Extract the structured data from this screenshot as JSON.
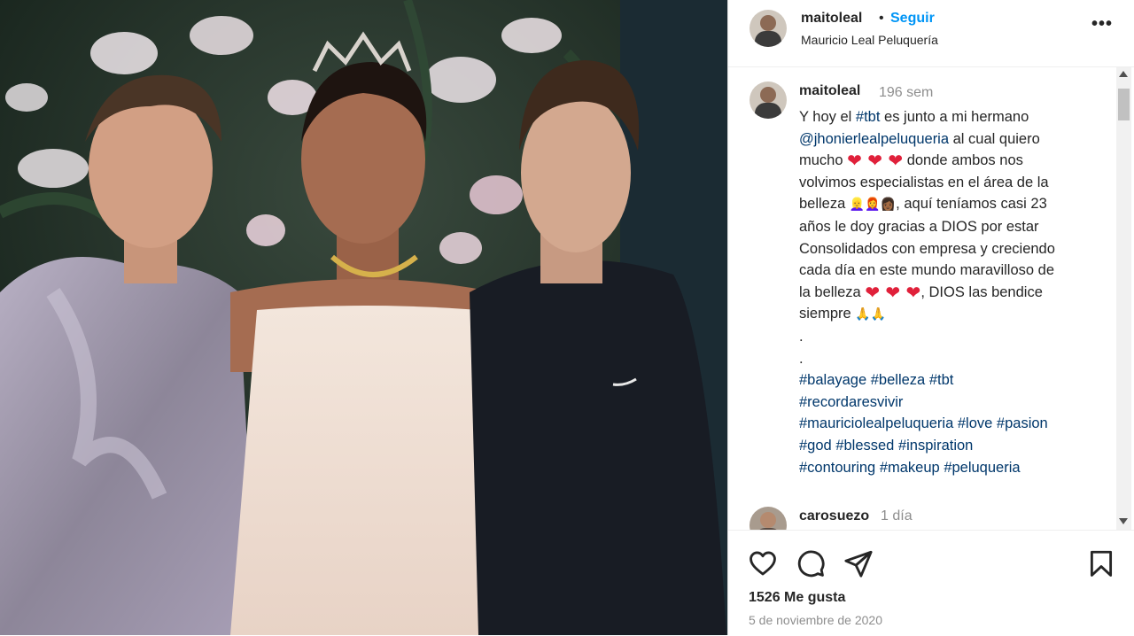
{
  "post": {
    "username": "maitoleal",
    "separator": "•",
    "follow_label": "Seguir",
    "location": "Mauricio Leal Peluquería",
    "more_label": "•••"
  },
  "caption": {
    "username": "maitoleal",
    "time": "196 sem",
    "line1_pre": "Y hoy el ",
    "line1_tag": "#tbt",
    "line1_post": " es junto a mi hermano",
    "mention": "@jhonierlealpeluqueria",
    "line2_post": " al cual quiero",
    "line3_pre": "mucho ",
    "line3_post": " donde ambos nos",
    "line4": "volvimos especialistas en el área de la",
    "line5_pre": "belleza ",
    "line5_post": ", aquí teníamos casi 23",
    "line6": "años le doy gracias a DIOS por estar",
    "line7": "Consolidados con empresa y creciendo",
    "line8": "cada día en este mundo maravilloso de",
    "line9_pre": "la belleza ",
    "line9_post": ", DIOS las bendice",
    "line10": "siempre ",
    "dot1": ".",
    "dot2": ".",
    "hearts": "❤ ❤ ❤",
    "women_emoji": "👱‍♀️👩‍🦰👩🏾",
    "pray_emoji": "🙏🙏",
    "hashtags_row1": [
      "#balayage",
      "#belleza",
      "#tbt"
    ],
    "hashtags_row2": [
      "#recordaresvivir"
    ],
    "hashtags_row3": [
      "#mauriciolealpeluqueria",
      "#love",
      "#pasion"
    ],
    "hashtags_row4": [
      "#god",
      "#blessed",
      "#inspiration"
    ],
    "hashtags_row5": [
      "#contouring",
      "#makeup",
      "#peluqueria"
    ]
  },
  "comment": {
    "username": "carosuezo",
    "time": "1 día"
  },
  "stats": {
    "likes": "1526 Me gusta",
    "date": "5 de noviembre de 2020"
  },
  "icons": {
    "like": "heart-icon",
    "comment": "comment-icon",
    "share": "share-icon",
    "save": "bookmark-icon"
  },
  "colors": {
    "follow": "#0095f6",
    "link": "#00376b",
    "muted": "#8e8e8e",
    "heart": "#e0203a"
  }
}
